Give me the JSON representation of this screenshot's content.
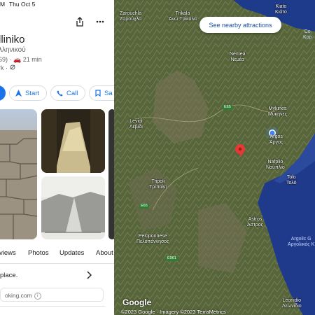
{
  "status_bar": {
    "time_fragment": "M",
    "date": "Thu Oct 5"
  },
  "place": {
    "title": "lliniko",
    "subtitle": "λληνικού",
    "rating_count": "69)",
    "drive_time": "21 min",
    "category_fragment": "rk"
  },
  "actions": {
    "start": "Start",
    "call": "Call",
    "save_fragment": "Sa"
  },
  "tabs": [
    "views",
    "Photos",
    "Updates",
    "About"
  ],
  "info_row": {
    "text": "place."
  },
  "card": {
    "text": "oking.com"
  },
  "map": {
    "nearby_button": "See nearby attractions",
    "brand": "Google",
    "credit": "©2023 Google · Imagery ©2023 TerraMetrics",
    "labels": {
      "zarouchla": "Zarouchla",
      "zarouchla_gr": "Ζαρούχλα",
      "trikala": "Trikala",
      "trikala_gr": "Άνω Τρίκαλα",
      "kiato": "Kiato",
      "kiato_gr": "Κιάτο",
      "nemea": "Nemea",
      "nemea_gr": "Νεμέα",
      "levidi": "Levidi",
      "levidi_gr": "Λεβίδι",
      "mykines": "Mykines",
      "mykines_gr": "Μυκήνες",
      "argos": "Argos",
      "argos_gr": "Άργος",
      "nafplio": "Nafplio",
      "nafplio_gr": "Ναύπλιο",
      "tolo": "Tolo",
      "tolo_gr": "Τολό",
      "tripoli": "Tripoli",
      "tripoli_gr": "Τρίπολη",
      "astros": "Astros",
      "astros_gr": "Άστρος",
      "peloponnese": "Peloponnese",
      "peloponnese_gr": "Πελοπόννησος",
      "argolic": "Argolic G",
      "argolic_gr": "Αργολικός Κ",
      "leonidio": "Leonidio",
      "leonidio_gr": "Λεωνίδιο",
      "right_top_1": "Co",
      "right_top_2": "Κορ",
      "road_e65_a": "E65",
      "road_e65_b": "E65",
      "road_e961": "E961"
    }
  },
  "colors": {
    "accent": "#1a73e8",
    "pin": "#e53935",
    "sea": "#1f3a8a"
  }
}
